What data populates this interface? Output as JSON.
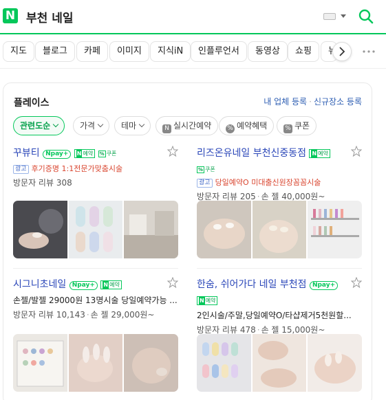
{
  "search": {
    "logo": "N",
    "query": "부천 네일"
  },
  "tabs": [
    "지도",
    "블로그",
    "카페",
    "이미지",
    "지식iN",
    "인플루언서",
    "동영상",
    "쇼핑",
    "뉴"
  ],
  "place": {
    "title": "플레이스",
    "link_register": "내 업체 등록",
    "link_new": "신규장소 등록",
    "filters": [
      {
        "label": "관련도순",
        "active": true,
        "icon": "chevron-down"
      },
      {
        "label": "가격",
        "active": false,
        "icon": "chevron-down"
      },
      {
        "label": "테마",
        "active": false,
        "icon": "chevron-down"
      },
      {
        "label": "실시간예약",
        "active": false,
        "icon": "n-booking-icon"
      },
      {
        "label": "예약혜택",
        "active": false,
        "icon": "percent-icon"
      },
      {
        "label": "쿠폰",
        "active": false,
        "icon": "coupon-icon"
      }
    ],
    "badges": {
      "npay": "pay",
      "booking": "예약",
      "coupon": "쿠폰",
      "ad": "광고"
    },
    "results": [
      {
        "name": "꾸뷰티",
        "promo": "후기증명 1:1전문가맞춤시술",
        "description": "",
        "review_label": "방문자 리뷰",
        "reviews": "308",
        "price": ""
      },
      {
        "name": "리즈온유네일 부천신중동점",
        "promo": "당일예약O 미대출신원장꼼꼼시술",
        "description": "",
        "review_label": "방문자 리뷰",
        "reviews": "205",
        "price": "손 젤 40,000원~"
      },
      {
        "name": "시그니초네일",
        "promo": "",
        "description": "손젤/발젤 29000원 13명시술 당일예약가능 ...",
        "review_label": "방문자 리뷰",
        "reviews": "10,143",
        "price": "손 젤 29,000원~"
      },
      {
        "name": "한숨, 쉬어가다 네일 부천점",
        "promo": "",
        "description": "2인시술/주말,당일예약O/타샵제거5천원할...",
        "review_label": "방문자 리뷰",
        "reviews": "478",
        "price": "손 젤 15,000원~"
      }
    ]
  },
  "colors": {
    "brand": "#03c75a",
    "link": "#2a46b8",
    "promo": "#d9452f"
  }
}
